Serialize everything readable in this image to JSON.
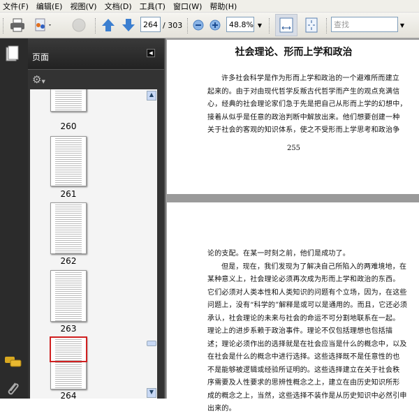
{
  "menu": [
    "文件(F)",
    "编辑(E)",
    "视图(V)",
    "文档(D)",
    "工具(T)",
    "窗口(W)",
    "帮助(H)"
  ],
  "toolbar": {
    "page_current": "264",
    "page_total": "/ 303",
    "zoom": "48.8%",
    "search_placeholder": "查找"
  },
  "sidebar": {
    "panel_title": "页面",
    "thumbnails": [
      "260",
      "261",
      "262",
      "263",
      "264"
    ],
    "selected": "264"
  },
  "pages": [
    {
      "title": "社会理论、形而上学和政治",
      "lines": [
        "许多社会科学是作为形而上学和政治的一个避难所而建立",
        "起来的。由于对由现代哲学反叛古代哲学而产生的观点充满信",
        "心，经典的社会理论家们急于先是把自己从形而上学的幻想中，",
        "接着从似乎是任意的政治判断中解放出来。他们想要创建一种",
        "关于社会的客观的知识体系，使之不受形而上学思考和政治争"
      ],
      "number": "255"
    },
    {
      "lines": [
        "论的支配。在某一时刻之前，他们是成功了。",
        "但是，现在，我们发现为了解决自己所陷入的两难境地，在",
        "某种意义上，社会理论必须再次成为形而上学和政治的东西。",
        "它们必须对人类本性和人类知识的问题有个立场，因为，在这些",
        "问题上，没有“科学的”解释是或可以是通用的。而且，它还必须",
        "承认，社会理论的未来与社会的命运不可分割地联系在一起。",
        "理论上的进步系赖于政治事件。理论不仅包括理想也包括描",
        "述；理论必须作出的选择就是在社会应当是什么的概念中，以及",
        "在社会是什么的概念中进行选择。这些选择既不是任意性的也",
        "不是能够被逻辑或经验所证明的。这些选择建立在关于社会秩",
        "序需要及人性要求的思辨性概念之上，建立在由历史知识所形",
        "成的概念之上，当然，这些选择不装作是从历史知识中必然引申",
        "出来的。"
      ]
    }
  ]
}
